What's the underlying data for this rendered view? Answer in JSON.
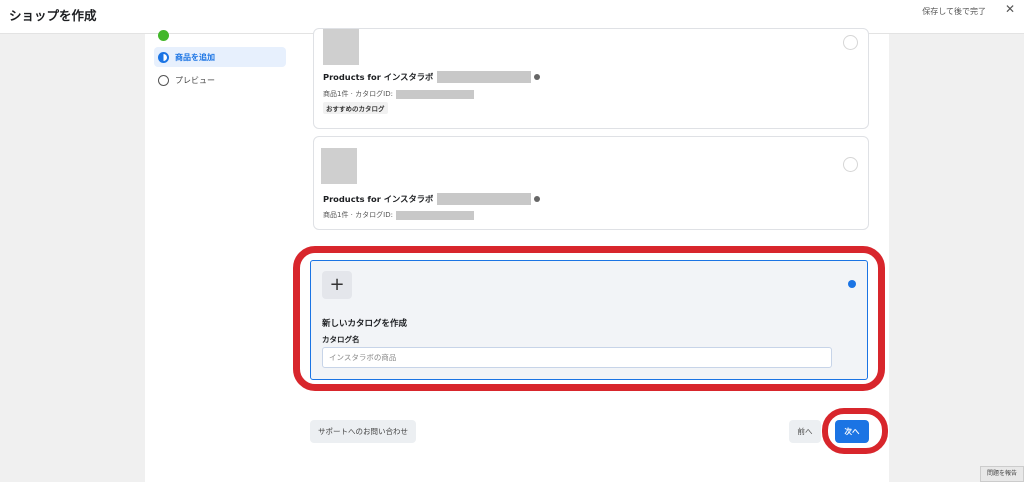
{
  "topbar": {
    "title": "ショップを作成",
    "save_exit_label": "保存して後で完了",
    "close_glyph": "✕"
  },
  "sidebar": {
    "steps": [
      {
        "label": "",
        "state": "done"
      },
      {
        "label": "商品を追加",
        "state": "active"
      },
      {
        "label": "プレビュー",
        "state": "todo"
      }
    ]
  },
  "catalogs": [
    {
      "name": "Products for インスタラボ",
      "meta": "商品1件 · カタログID:",
      "badge": "おすすめのカタログ"
    },
    {
      "name": "Products for インスタラボ",
      "meta": "商品1件 · カタログID:"
    }
  ],
  "new_catalog": {
    "plus_glyph": "+",
    "title": "新しいカタログを作成",
    "field_label": "カタログ名",
    "input_value": "インスタラボの商品"
  },
  "footer": {
    "support_label": "サポートへのお問い合わせ",
    "back_label": "前へ",
    "next_label": "次へ"
  },
  "corner_tip": "問題を報告",
  "colors": {
    "accent": "#1b74e4",
    "highlight": "#d8262c",
    "done": "#42b72a"
  }
}
